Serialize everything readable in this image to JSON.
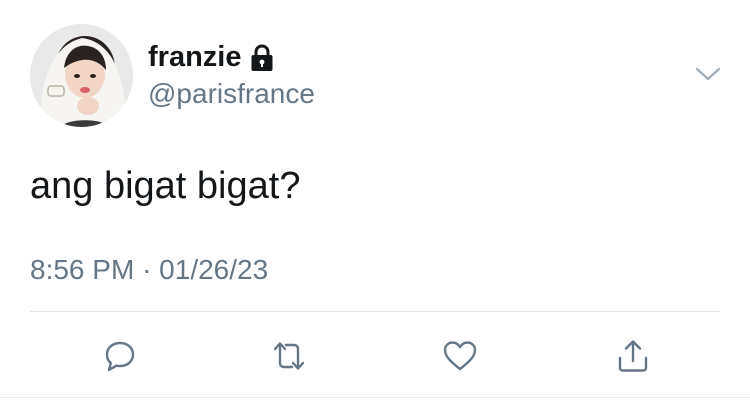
{
  "user": {
    "display_name": "franzie",
    "handle": "@parisfrance",
    "protected_icon": "lock-icon"
  },
  "tweet": {
    "text": "ang bigat bigat?",
    "time": "8:56 PM",
    "separator": "·",
    "date": "01/26/23"
  },
  "actions": [
    {
      "name": "reply",
      "icon": "reply-bubble-icon"
    },
    {
      "name": "retweet",
      "icon": "retweet-icon"
    },
    {
      "name": "like",
      "icon": "heart-icon"
    },
    {
      "name": "share",
      "icon": "share-upload-icon"
    }
  ],
  "menu_icon": "chevron-down-icon",
  "colors": {
    "text": "#14171a",
    "secondary": "#657786",
    "divider": "#e1e8ed"
  }
}
